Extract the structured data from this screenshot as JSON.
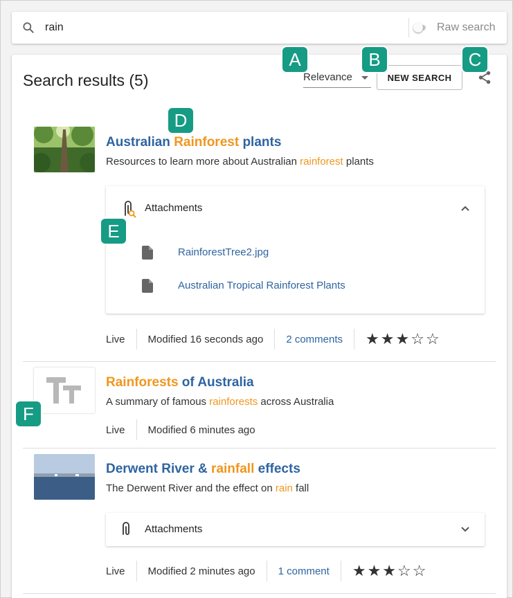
{
  "search": {
    "query": "rain",
    "raw_label": "Raw search"
  },
  "header": {
    "title": "Search results (5)",
    "sort_value": "Relevance",
    "new_search_label": "NEW SEARCH"
  },
  "callouts": [
    "A",
    "B",
    "C",
    "D",
    "E",
    "F"
  ],
  "results": [
    {
      "title_parts": [
        "Australian ",
        "Rainforest",
        " plants"
      ],
      "desc_parts": [
        "Resources to learn more about Australian ",
        "rainforest",
        " plants"
      ],
      "attachments_label": "Attachments",
      "attachments": [
        "RainforestTree2.jpg",
        "Australian Tropical Rainforest Plants"
      ],
      "status": "Live",
      "modified": "Modified 16 seconds ago",
      "comments": "2 comments",
      "rating": 3
    },
    {
      "title_parts": [
        "Rainforests",
        " of Australia"
      ],
      "desc_parts": [
        "A summary of famous ",
        "rainforests",
        " across Australia"
      ],
      "status": "Live",
      "modified": "Modified 6 minutes ago"
    },
    {
      "title_parts": [
        "Derwent River & ",
        "rainfall",
        " effects"
      ],
      "desc_parts": [
        "The Derwent River and the effect on ",
        "rain",
        " fall"
      ],
      "attachments_label": "Attachments",
      "status": "Live",
      "modified": "Modified 2 minutes ago",
      "comments": "1 comment",
      "rating": 3
    }
  ],
  "colors": {
    "highlight": "#f0961e",
    "link": "#2e64a0",
    "callout": "#169b84"
  }
}
